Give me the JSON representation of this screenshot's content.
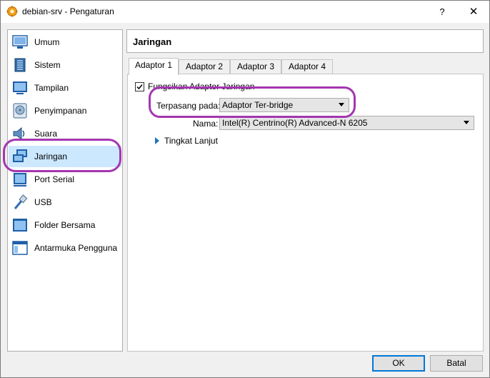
{
  "window": {
    "title": "debian-srv - Pengaturan",
    "help_label": "?",
    "close_label": "✕"
  },
  "sidebar": {
    "items": [
      {
        "label": "Umum",
        "icon": "monitor-icon"
      },
      {
        "label": "Sistem",
        "icon": "chip-icon"
      },
      {
        "label": "Tampilan",
        "icon": "display-icon"
      },
      {
        "label": "Penyimpanan",
        "icon": "disk-icon"
      },
      {
        "label": "Suara",
        "icon": "speaker-icon"
      },
      {
        "label": "Jaringan",
        "icon": "network-icon",
        "selected": true
      },
      {
        "label": "Port Serial",
        "icon": "serial-port-icon"
      },
      {
        "label": "USB",
        "icon": "usb-icon"
      },
      {
        "label": "Folder Bersama",
        "icon": "folder-icon"
      },
      {
        "label": "Antarmuka Pengguna",
        "icon": "window-icon"
      }
    ]
  },
  "page": {
    "title": "Jaringan"
  },
  "tabs": [
    {
      "label": "Adaptor 1",
      "active": true
    },
    {
      "label": "Adaptor 2"
    },
    {
      "label": "Adaptor 3"
    },
    {
      "label": "Adaptor 4"
    }
  ],
  "adapter": {
    "enable_label": "Fungsikan Adaptor Jaringan",
    "enabled": true,
    "attached_label": "Terpasang pada:",
    "attached_value": "Adaptor Ter-bridge",
    "name_label": "Nama:",
    "name_value": "Intel(R) Centrino(R) Advanced-N 6205",
    "advanced_label": "Tingkat Lanjut"
  },
  "buttons": {
    "ok": "OK",
    "cancel": "Batal"
  },
  "colors": {
    "highlight": "#a436b0",
    "selected_bg": "#cce8ff",
    "accent": "#1e73be"
  }
}
